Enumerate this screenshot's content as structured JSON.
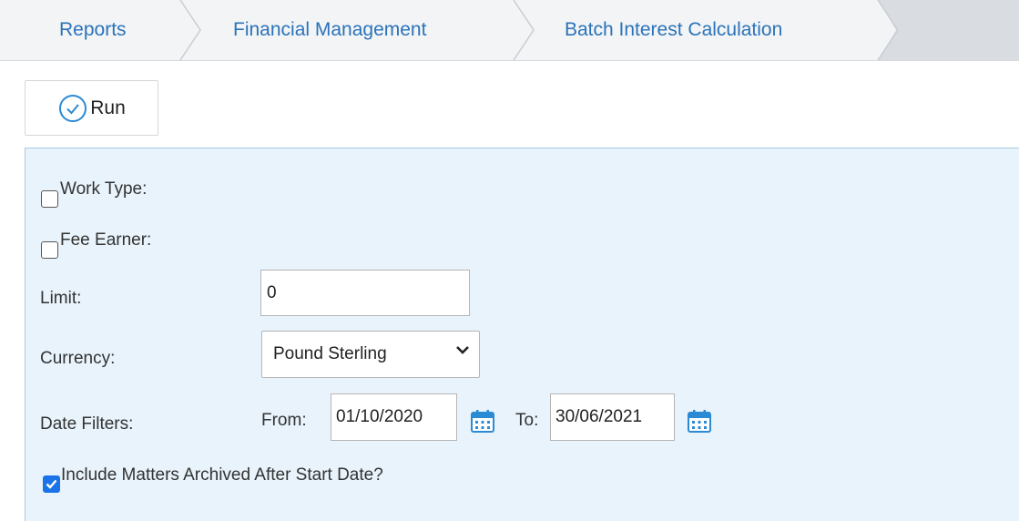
{
  "breadcrumb": {
    "items": [
      {
        "label": "Reports"
      },
      {
        "label": "Financial Management"
      },
      {
        "label": "Batch Interest Calculation"
      }
    ]
  },
  "toolbar": {
    "run_label": "Run",
    "run_icon": "check-circle-icon"
  },
  "form": {
    "work_type": {
      "label": "Work Type:",
      "checked": false
    },
    "fee_earner": {
      "label": "Fee Earner:",
      "checked": false
    },
    "limit": {
      "label": "Limit:",
      "value": "0"
    },
    "currency": {
      "label": "Currency:",
      "selected": "Pound Sterling"
    },
    "date_filters": {
      "label": "Date Filters:",
      "from_label": "From:",
      "from_value": "01/10/2020",
      "to_label": "To:",
      "to_value": "30/06/2021",
      "calendar_icon": "calendar-icon"
    },
    "include_archived": {
      "label": "Include Matters Archived After Start Date?",
      "checked": true
    }
  },
  "colors": {
    "link_blue": "#2b73b9",
    "panel_bg": "#e8f3fb",
    "checkbox_blue": "#1a73e8"
  }
}
